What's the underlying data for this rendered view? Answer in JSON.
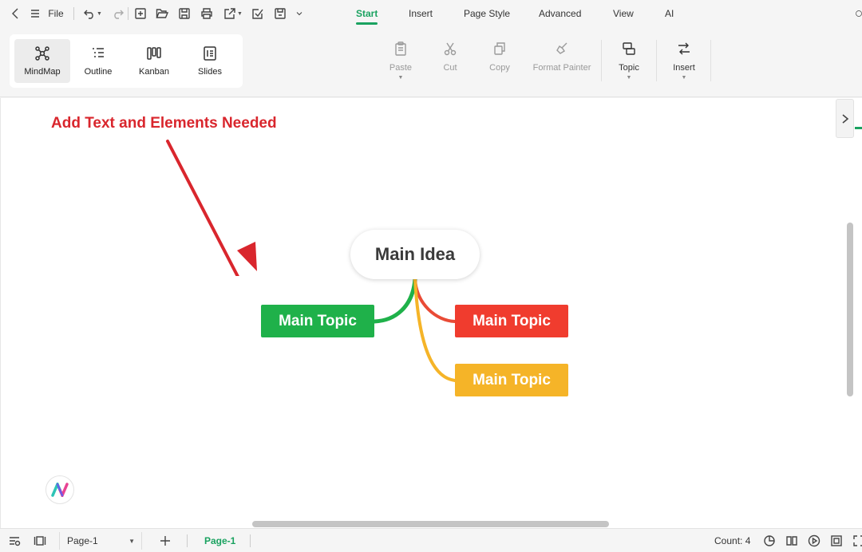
{
  "menubar": {
    "file_label": "File",
    "tabs": [
      {
        "label": "Start",
        "active": true
      },
      {
        "label": "Insert"
      },
      {
        "label": "Page Style"
      },
      {
        "label": "Advanced"
      },
      {
        "label": "View"
      },
      {
        "label": "AI"
      }
    ]
  },
  "ribbon": {
    "views": [
      {
        "label": "MindMap",
        "icon": "mindmap-icon",
        "active": true
      },
      {
        "label": "Outline",
        "icon": "outline-icon"
      },
      {
        "label": "Kanban",
        "icon": "kanban-icon"
      },
      {
        "label": "Slides",
        "icon": "slides-icon"
      }
    ],
    "actions": [
      {
        "label": "Paste",
        "icon": "clipboard-icon"
      },
      {
        "label": "Cut",
        "icon": "scissors-icon"
      },
      {
        "label": "Copy",
        "icon": "copy-icon"
      },
      {
        "label": "Format Painter",
        "icon": "brush-icon"
      },
      {
        "label": "Topic",
        "icon": "topic-icon"
      },
      {
        "label": "Insert",
        "icon": "insert-icon"
      }
    ]
  },
  "canvas": {
    "annotation": "Add Text and Elements Needed",
    "main_idea": "Main Idea",
    "topics": [
      {
        "label": "Main Topic",
        "color": "#1fb14a"
      },
      {
        "label": "Main Topic",
        "color": "#f03c2e"
      },
      {
        "label": "Main Topic",
        "color": "#f5b428"
      }
    ],
    "annotation_color": "#d9262d",
    "accent": "#1aa260"
  },
  "statusbar": {
    "page_select": "Page-1",
    "page_tab": "Page-1",
    "count": "Count: 4"
  }
}
